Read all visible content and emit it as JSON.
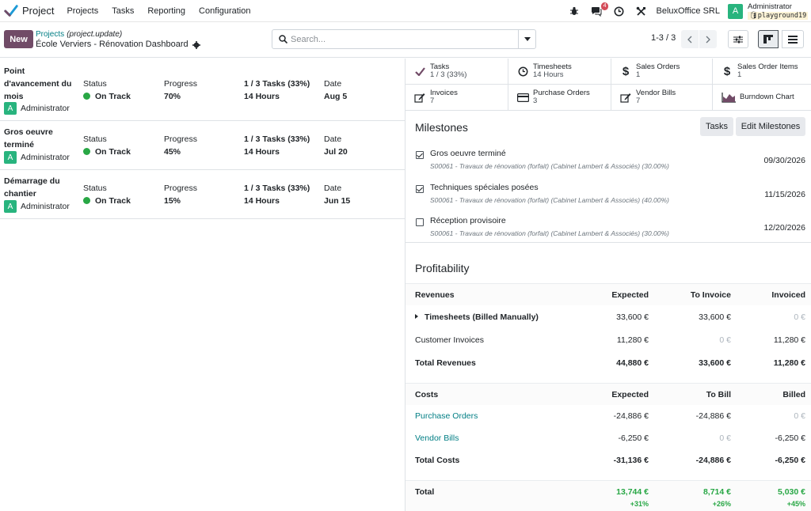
{
  "nav": {
    "app_name": "Project",
    "menus": [
      "Projects",
      "Tasks",
      "Reporting",
      "Configuration"
    ],
    "chat_badge": "4",
    "company": "BeluxOffice SRL",
    "user_initial": "A",
    "user_name": "Administrator",
    "db_name": "playground19",
    "icons": [
      "bug-icon",
      "chat-icon",
      "clock-icon",
      "tools-icon"
    ]
  },
  "control": {
    "new_label": "New",
    "breadcrumb_link": "Projects",
    "breadcrumb_model": "(project.update)",
    "breadcrumb_current": "École Verviers - Rénovation Dashboard",
    "search_placeholder": "Search...",
    "pager": "1-3 / 3"
  },
  "updates": [
    {
      "name": "Point d'avancement du mois",
      "user": "Administrator",
      "status_label": "Status",
      "status": "On Track",
      "progress_label": "Progress",
      "progress": "70%",
      "tasks": "1 / 3 Tasks (33%)",
      "hours": "14 Hours",
      "date_label": "Date",
      "date": "Aug 5"
    },
    {
      "name": "Gros oeuvre terminé",
      "user": "Administrator",
      "status_label": "Status",
      "status": "On Track",
      "progress_label": "Progress",
      "progress": "45%",
      "tasks": "1 / 3 Tasks (33%)",
      "hours": "14 Hours",
      "date_label": "Date",
      "date": "Jul 20"
    },
    {
      "name": "Démarrage du chantier",
      "user": "Administrator",
      "status_label": "Status",
      "status": "On Track",
      "progress_label": "Progress",
      "progress": "15%",
      "tasks": "1 / 3 Tasks (33%)",
      "hours": "14 Hours",
      "date_label": "Date",
      "date": "Jun 15"
    }
  ],
  "stats": [
    {
      "label": "Tasks",
      "value": "1 / 3 (33%)",
      "icon": "check-icon"
    },
    {
      "label": "Timesheets",
      "value": "14 Hours",
      "icon": "clock-icon"
    },
    {
      "label": "Sales Orders",
      "value": "1",
      "icon": "dollar-icon"
    },
    {
      "label": "Sales Order Items",
      "value": "1",
      "icon": "dollar-icon"
    },
    {
      "label": "Invoices",
      "value": "7",
      "icon": "pencil-square-icon"
    },
    {
      "label": "Purchase Orders",
      "value": "3",
      "icon": "credit-card-icon"
    },
    {
      "label": "Vendor Bills",
      "value": "7",
      "icon": "pencil-square-icon"
    },
    {
      "label": "Burndown Chart",
      "value": "",
      "icon": "area-chart-icon"
    }
  ],
  "milestones": {
    "title": "Milestones",
    "tasks_btn": "Tasks",
    "edit_btn": "Edit Milestones",
    "items": [
      {
        "name": "Gros oeuvre terminé",
        "sub": "S00061 - Travaux de rénovation (forfait) (Cabinet Lambert & Associés) (30.00%)",
        "date": "09/30/2026",
        "done": true
      },
      {
        "name": "Techniques spéciales posées",
        "sub": "S00061 - Travaux de rénovation (forfait) (Cabinet Lambert & Associés) (40.00%)",
        "date": "11/15/2026",
        "done": true
      },
      {
        "name": "Réception provisoire",
        "sub": "S00061 - Travaux de rénovation (forfait) (Cabinet Lambert & Associés) (30.00%)",
        "date": "12/20/2026",
        "done": false
      }
    ]
  },
  "profitability": {
    "title": "Profitability",
    "revenues_head": [
      "Revenues",
      "Expected",
      "To Invoice",
      "Invoiced"
    ],
    "revenues": [
      {
        "label": "Timesheets (Billed Manually)",
        "expected": "33,600 €",
        "to": "33,600 €",
        "done": "0 €"
      },
      {
        "label": "Customer Invoices",
        "expected": "11,280 €",
        "to": "0 €",
        "done": "11,280 €"
      }
    ],
    "total_revenues": {
      "label": "Total Revenues",
      "expected": "44,880 €",
      "to": "33,600 €",
      "done": "11,280 €"
    },
    "costs_head": [
      "Costs",
      "Expected",
      "To Bill",
      "Billed"
    ],
    "costs": [
      {
        "label": "Purchase Orders",
        "expected": "-24,886 €",
        "to": "-24,886 €",
        "done": "0 €"
      },
      {
        "label": "Vendor Bills",
        "expected": "-6,250 €",
        "to": "0 €",
        "done": "-6,250 €"
      }
    ],
    "total_costs": {
      "label": "Total Costs",
      "expected": "-31,136 €",
      "to": "-24,886 €",
      "done": "-6,250 €"
    },
    "total": {
      "label": "Total",
      "expected": "13,744 €",
      "to": "8,714 €",
      "done": "5,030 €",
      "expected_pct": "+31%",
      "to_pct": "+26%",
      "done_pct": "+45%"
    }
  },
  "colors": {
    "brand": "#714b67",
    "link": "#017e84",
    "success": "#28a745",
    "avatar": "#28b47e"
  }
}
